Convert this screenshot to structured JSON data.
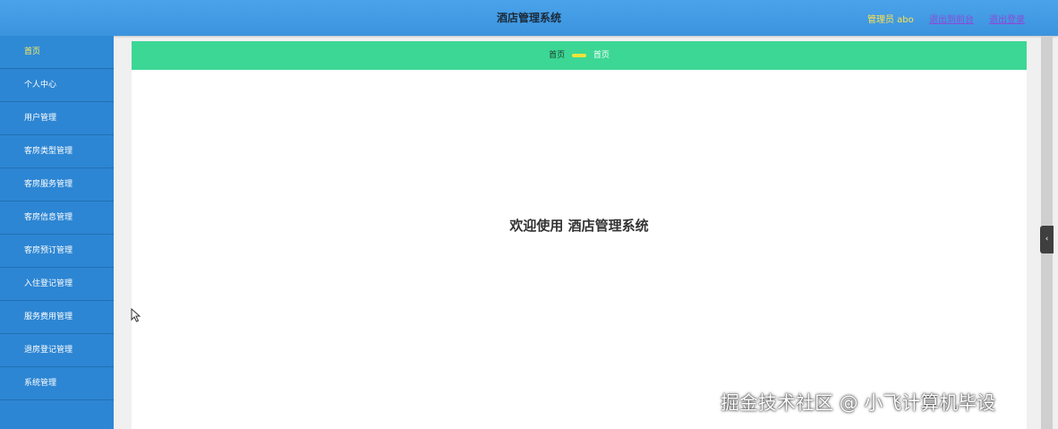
{
  "header": {
    "title": "酒店管理系统",
    "user": "管理员 abo",
    "link_front": "退出到前台",
    "link_logout": "退出登录"
  },
  "sidebar": {
    "items": [
      {
        "label": "首页",
        "active": true
      },
      {
        "label": "个人中心"
      },
      {
        "label": "用户管理"
      },
      {
        "label": "客房类型管理"
      },
      {
        "label": "客房服务管理"
      },
      {
        "label": "客房信息管理"
      },
      {
        "label": "客房预订管理"
      },
      {
        "label": "入住登记管理"
      },
      {
        "label": "服务费用管理"
      },
      {
        "label": "退房登记管理"
      },
      {
        "label": "系统管理"
      }
    ]
  },
  "breadcrumb": {
    "root": "首页",
    "current": "首页"
  },
  "main": {
    "welcome": "欢迎使用 酒店管理系统"
  },
  "watermark": "掘金技术社区 @ 小飞计算机毕设",
  "colors": {
    "header": "#3b93de",
    "sidebar": "#2d86d3",
    "breadcrumb": "#3cd795",
    "active_text": "#ffee58"
  }
}
